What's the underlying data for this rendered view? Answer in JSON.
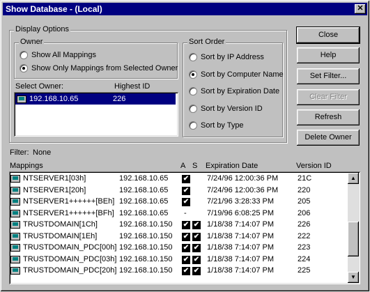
{
  "window": {
    "title": "Show Database - (Local)",
    "close_glyph": "✕"
  },
  "display_options": {
    "label": "Display Options",
    "owner": {
      "label": "Owner",
      "options": [
        "Show All Mappings",
        "Show Only Mappings from Selected Owner"
      ],
      "selected": 1
    },
    "select_owner": {
      "label": "Select Owner:",
      "highest_id_label": "Highest ID",
      "rows": [
        {
          "owner": "192.168.10.65",
          "highest_id": "226"
        }
      ]
    },
    "sort_order": {
      "label": "Sort Order",
      "options": [
        "Sort by IP Address",
        "Sort by Computer Name",
        "Sort by Expiration Date",
        "Sort by Version ID",
        "Sort by Type"
      ],
      "selected": 1
    }
  },
  "buttons": {
    "close": "Close",
    "help": "Help",
    "set_filter": "Set Filter...",
    "clear_filter": "Clear Filter",
    "refresh": "Refresh",
    "delete_owner": "Delete Owner"
  },
  "filter": {
    "label": "Filter:",
    "value": "None"
  },
  "mappings": {
    "headers": {
      "name": "Mappings",
      "a": "A",
      "s": "S",
      "expiration": "Expiration Date",
      "version": "Version ID"
    },
    "rows": [
      {
        "name": "NTSERVER1[03h]",
        "ip": "192.168.10.65",
        "a": true,
        "s": false,
        "expiration": "7/24/96 12:00:36 PM",
        "version": "21C",
        "icon": "computer-icon"
      },
      {
        "name": "NTSERVER1[20h]",
        "ip": "192.168.10.65",
        "a": true,
        "s": false,
        "expiration": "7/24/96 12:00:36 PM",
        "version": "220",
        "icon": "computer-icon"
      },
      {
        "name": "NTSERVER1++++++[BEh]",
        "ip": "192.168.10.65",
        "a": true,
        "s": false,
        "expiration": "7/21/96 3:28:33 PM",
        "version": "205",
        "icon": "computer-icon"
      },
      {
        "name": "NTSERVER1++++++[BFh]",
        "ip": "192.168.10.65",
        "a": false,
        "a_text": "-",
        "s": false,
        "expiration": "7/19/96 6:08:25 PM",
        "version": "206",
        "icon": "computer-icon"
      },
      {
        "name": "TRUSTDOMAIN[1Ch]",
        "ip": "192.168.10.150",
        "a": true,
        "s": true,
        "expiration": "1/18/38 7:14:07 PM",
        "version": "226",
        "icon": "domain-icon"
      },
      {
        "name": "TRUSTDOMAIN[1Eh]",
        "ip": "192.168.10.150",
        "a": true,
        "s": true,
        "expiration": "1/18/38 7:14:07 PM",
        "version": "222",
        "icon": "domain-icon"
      },
      {
        "name": "TRUSTDOMAIN_PDC[00h]",
        "ip": "192.168.10.150",
        "a": true,
        "s": true,
        "expiration": "1/18/38 7:14:07 PM",
        "version": "223",
        "icon": "computer-icon"
      },
      {
        "name": "TRUSTDOMAIN_PDC[03h]",
        "ip": "192.168.10.150",
        "a": true,
        "s": true,
        "expiration": "1/18/38 7:14:07 PM",
        "version": "224",
        "icon": "computer-icon"
      },
      {
        "name": "TRUSTDOMAIN_PDC[20h]",
        "ip": "192.168.10.150",
        "a": true,
        "s": true,
        "expiration": "1/18/38 7:14:07 PM",
        "version": "225",
        "icon": "computer-icon"
      }
    ]
  },
  "colors": {
    "titlebar": "#000080",
    "face": "#c0c0c0",
    "selection": "#000080"
  }
}
